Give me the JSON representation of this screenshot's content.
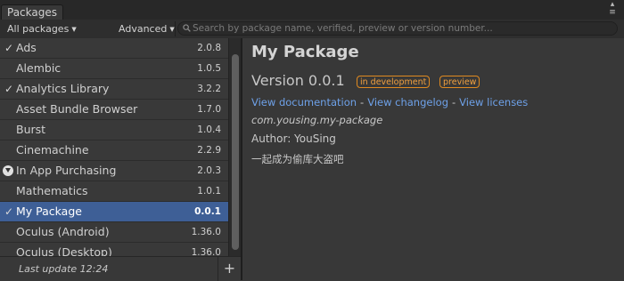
{
  "window": {
    "tab_title": "Packages"
  },
  "toolbar": {
    "filter_dropdown": "All packages",
    "advanced_dropdown": "Advanced",
    "search_placeholder": "Search by package name, verified, preview or version number..."
  },
  "packages": [
    {
      "name": "Ads",
      "version": "2.0.8",
      "status": "installed"
    },
    {
      "name": "Alembic",
      "version": "1.0.5",
      "status": "none"
    },
    {
      "name": "Analytics Library",
      "version": "3.2.2",
      "status": "installed"
    },
    {
      "name": "Asset Bundle Browser",
      "version": "1.7.0",
      "status": "none"
    },
    {
      "name": "Burst",
      "version": "1.0.4",
      "status": "none"
    },
    {
      "name": "Cinemachine",
      "version": "2.2.9",
      "status": "none"
    },
    {
      "name": "In App Purchasing",
      "version": "2.0.3",
      "status": "download"
    },
    {
      "name": "Mathematics",
      "version": "1.0.1",
      "status": "none"
    },
    {
      "name": "My Package",
      "version": "0.0.1",
      "status": "installed",
      "selected": true
    },
    {
      "name": "Oculus (Android)",
      "version": "1.36.0",
      "status": "none"
    },
    {
      "name": "Oculus (Desktop)",
      "version": "1.36.0",
      "status": "none"
    }
  ],
  "footer": {
    "last_update": "Last update 12:24",
    "add_label": "+"
  },
  "details": {
    "title": "My Package",
    "version": "Version 0.0.1",
    "badges": [
      "in development",
      "preview"
    ],
    "links": [
      "View documentation",
      "View changelog",
      "View licenses"
    ],
    "package_id": "com.yousing.my-package",
    "author": "Author: YouSing",
    "description": "一起成为偷库大盗吧"
  },
  "colors": {
    "selection": "#3e5f96",
    "link": "#6ea1e8",
    "badge": "#e08a20"
  }
}
